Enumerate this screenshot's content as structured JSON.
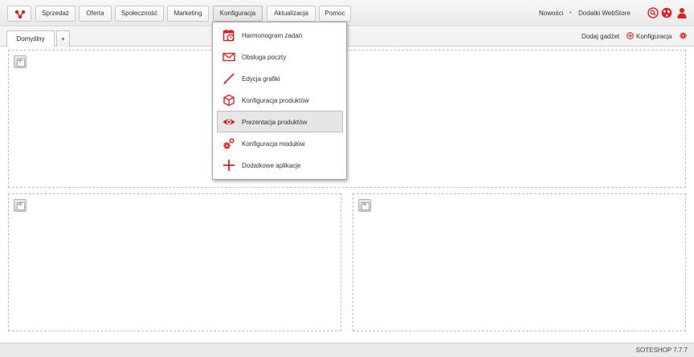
{
  "nav": {
    "items": [
      {
        "label": "Sprzedaż"
      },
      {
        "label": "Oferta"
      },
      {
        "label": "Społeczność"
      },
      {
        "label": "Marketing"
      },
      {
        "label": "Konfiguracja",
        "active": true
      },
      {
        "label": "Aktualizacja"
      },
      {
        "label": "Pomoc"
      }
    ],
    "links": {
      "news": "Nowości",
      "separator": "•",
      "webstore": "Dodatki WebStore"
    },
    "icons": [
      "search-icon",
      "globe-icon",
      "user-icon"
    ]
  },
  "tabs": {
    "default": "Domyślny",
    "add": "+"
  },
  "toolbar": {
    "add_gadget": "Dodaj gadżet",
    "config": "Konfiguracja"
  },
  "dropdown": {
    "items": [
      {
        "label": "Harmonogram zadań",
        "icon": "calendar-clock-icon"
      },
      {
        "label": "Obsługa poczty",
        "icon": "envelope-icon"
      },
      {
        "label": "Edycja grafiki",
        "icon": "brush-icon"
      },
      {
        "label": "Konfiguracja produktów",
        "icon": "box-icon"
      },
      {
        "label": "Prezentacja produktów",
        "icon": "eye-icon",
        "hover": true
      },
      {
        "label": "Konfiguracja modułów",
        "icon": "gears-icon"
      },
      {
        "label": "Dodatkowe aplikacje",
        "icon": "plus-icon"
      }
    ]
  },
  "footer": {
    "version": "SOTESHOP 7.7.7"
  },
  "colors": {
    "accent": "#e02020",
    "hover": "#e6e6e6"
  }
}
